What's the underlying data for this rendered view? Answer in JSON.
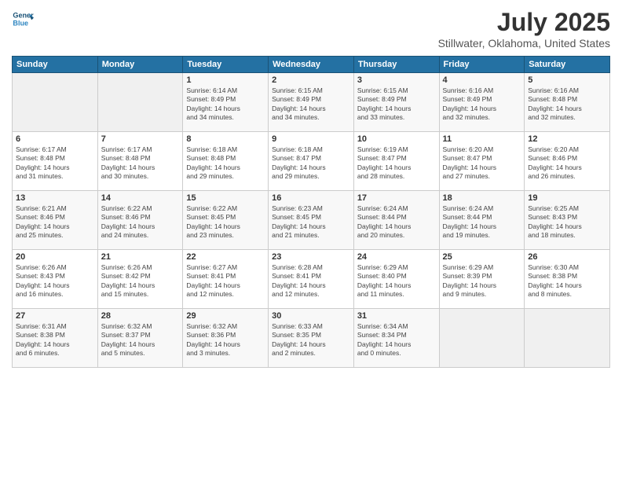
{
  "header": {
    "logo_line1": "General",
    "logo_line2": "Blue",
    "title": "July 2025",
    "subtitle": "Stillwater, Oklahoma, United States"
  },
  "days_of_week": [
    "Sunday",
    "Monday",
    "Tuesday",
    "Wednesday",
    "Thursday",
    "Friday",
    "Saturday"
  ],
  "weeks": [
    [
      {
        "day": "",
        "info": ""
      },
      {
        "day": "",
        "info": ""
      },
      {
        "day": "1",
        "info": "Sunrise: 6:14 AM\nSunset: 8:49 PM\nDaylight: 14 hours\nand 34 minutes."
      },
      {
        "day": "2",
        "info": "Sunrise: 6:15 AM\nSunset: 8:49 PM\nDaylight: 14 hours\nand 34 minutes."
      },
      {
        "day": "3",
        "info": "Sunrise: 6:15 AM\nSunset: 8:49 PM\nDaylight: 14 hours\nand 33 minutes."
      },
      {
        "day": "4",
        "info": "Sunrise: 6:16 AM\nSunset: 8:49 PM\nDaylight: 14 hours\nand 32 minutes."
      },
      {
        "day": "5",
        "info": "Sunrise: 6:16 AM\nSunset: 8:48 PM\nDaylight: 14 hours\nand 32 minutes."
      }
    ],
    [
      {
        "day": "6",
        "info": "Sunrise: 6:17 AM\nSunset: 8:48 PM\nDaylight: 14 hours\nand 31 minutes."
      },
      {
        "day": "7",
        "info": "Sunrise: 6:17 AM\nSunset: 8:48 PM\nDaylight: 14 hours\nand 30 minutes."
      },
      {
        "day": "8",
        "info": "Sunrise: 6:18 AM\nSunset: 8:48 PM\nDaylight: 14 hours\nand 29 minutes."
      },
      {
        "day": "9",
        "info": "Sunrise: 6:18 AM\nSunset: 8:47 PM\nDaylight: 14 hours\nand 29 minutes."
      },
      {
        "day": "10",
        "info": "Sunrise: 6:19 AM\nSunset: 8:47 PM\nDaylight: 14 hours\nand 28 minutes."
      },
      {
        "day": "11",
        "info": "Sunrise: 6:20 AM\nSunset: 8:47 PM\nDaylight: 14 hours\nand 27 minutes."
      },
      {
        "day": "12",
        "info": "Sunrise: 6:20 AM\nSunset: 8:46 PM\nDaylight: 14 hours\nand 26 minutes."
      }
    ],
    [
      {
        "day": "13",
        "info": "Sunrise: 6:21 AM\nSunset: 8:46 PM\nDaylight: 14 hours\nand 25 minutes."
      },
      {
        "day": "14",
        "info": "Sunrise: 6:22 AM\nSunset: 8:46 PM\nDaylight: 14 hours\nand 24 minutes."
      },
      {
        "day": "15",
        "info": "Sunrise: 6:22 AM\nSunset: 8:45 PM\nDaylight: 14 hours\nand 23 minutes."
      },
      {
        "day": "16",
        "info": "Sunrise: 6:23 AM\nSunset: 8:45 PM\nDaylight: 14 hours\nand 21 minutes."
      },
      {
        "day": "17",
        "info": "Sunrise: 6:24 AM\nSunset: 8:44 PM\nDaylight: 14 hours\nand 20 minutes."
      },
      {
        "day": "18",
        "info": "Sunrise: 6:24 AM\nSunset: 8:44 PM\nDaylight: 14 hours\nand 19 minutes."
      },
      {
        "day": "19",
        "info": "Sunrise: 6:25 AM\nSunset: 8:43 PM\nDaylight: 14 hours\nand 18 minutes."
      }
    ],
    [
      {
        "day": "20",
        "info": "Sunrise: 6:26 AM\nSunset: 8:43 PM\nDaylight: 14 hours\nand 16 minutes."
      },
      {
        "day": "21",
        "info": "Sunrise: 6:26 AM\nSunset: 8:42 PM\nDaylight: 14 hours\nand 15 minutes."
      },
      {
        "day": "22",
        "info": "Sunrise: 6:27 AM\nSunset: 8:41 PM\nDaylight: 14 hours\nand 12 minutes."
      },
      {
        "day": "23",
        "info": "Sunrise: 6:28 AM\nSunset: 8:41 PM\nDaylight: 14 hours\nand 12 minutes."
      },
      {
        "day": "24",
        "info": "Sunrise: 6:29 AM\nSunset: 8:40 PM\nDaylight: 14 hours\nand 11 minutes."
      },
      {
        "day": "25",
        "info": "Sunrise: 6:29 AM\nSunset: 8:39 PM\nDaylight: 14 hours\nand 9 minutes."
      },
      {
        "day": "26",
        "info": "Sunrise: 6:30 AM\nSunset: 8:38 PM\nDaylight: 14 hours\nand 8 minutes."
      }
    ],
    [
      {
        "day": "27",
        "info": "Sunrise: 6:31 AM\nSunset: 8:38 PM\nDaylight: 14 hours\nand 6 minutes."
      },
      {
        "day": "28",
        "info": "Sunrise: 6:32 AM\nSunset: 8:37 PM\nDaylight: 14 hours\nand 5 minutes."
      },
      {
        "day": "29",
        "info": "Sunrise: 6:32 AM\nSunset: 8:36 PM\nDaylight: 14 hours\nand 3 minutes."
      },
      {
        "day": "30",
        "info": "Sunrise: 6:33 AM\nSunset: 8:35 PM\nDaylight: 14 hours\nand 2 minutes."
      },
      {
        "day": "31",
        "info": "Sunrise: 6:34 AM\nSunset: 8:34 PM\nDaylight: 14 hours\nand 0 minutes."
      },
      {
        "day": "",
        "info": ""
      },
      {
        "day": "",
        "info": ""
      }
    ]
  ]
}
